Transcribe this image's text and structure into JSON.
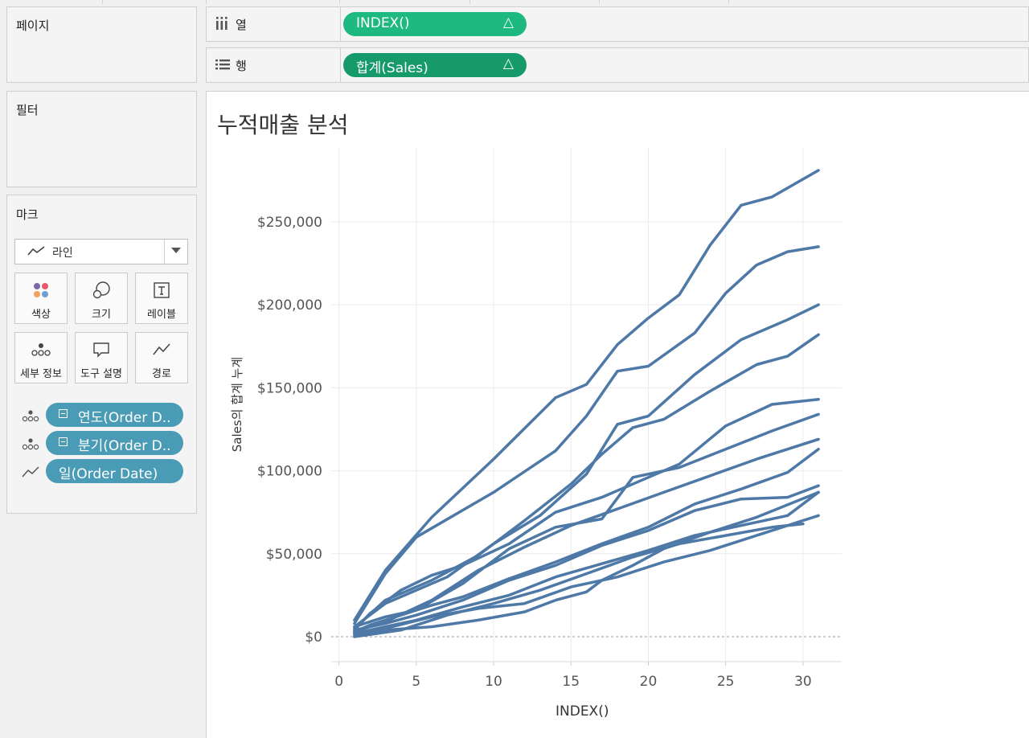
{
  "shelves": {
    "pages_label": "페이지",
    "columns": {
      "label": "열",
      "pill": "INDEX()",
      "pill_color": "#1db980"
    },
    "rows": {
      "label": "행",
      "pill": "합계(Sales)",
      "pill_color": "#169a6b"
    }
  },
  "filters": {
    "label": "필터"
  },
  "marks": {
    "label": "마크",
    "type": "라인",
    "buttons": {
      "color": "색상",
      "size": "크기",
      "label": "레이블",
      "detail": "세부 정보",
      "tooltip": "도구 설명",
      "path": "경로"
    },
    "fields": [
      {
        "text": "연도(Order D..",
        "role": "detail"
      },
      {
        "text": "분기(Order D..",
        "role": "detail"
      },
      {
        "text": "일(Order Date)",
        "role": "path"
      }
    ],
    "field_color": "#4a9bb5"
  },
  "sheet": {
    "title": "누적매출 분석"
  },
  "chart_data": {
    "type": "line",
    "title": "누적매출 분석",
    "xlabel": "INDEX()",
    "ylabel": "Sales의 합계 누계",
    "xlim": [
      -0.5,
      32.5
    ],
    "ylim": [
      -15000,
      295000
    ],
    "xticks": [
      0,
      5,
      10,
      15,
      20,
      25,
      30
    ],
    "yticks": [
      0,
      50000,
      100000,
      150000,
      200000,
      250000
    ],
    "ytick_labels": [
      "$0",
      "$50,000",
      "$100,000",
      "$150,000",
      "$200,000",
      "$250,000"
    ],
    "line_color": "#4e79a7",
    "grid": true,
    "zero_line": "dashed",
    "series": [
      {
        "x": [
          1,
          3,
          6,
          10,
          14,
          16,
          18,
          20,
          22,
          24,
          26,
          28,
          31
        ],
        "values": [
          10000,
          40000,
          72000,
          107000,
          144000,
          152000,
          176000,
          192000,
          206000,
          236000,
          260000,
          265000,
          281000
        ]
      },
      {
        "x": [
          1,
          3,
          5,
          10,
          14,
          16,
          18,
          20,
          23,
          25,
          27,
          29,
          31
        ],
        "values": [
          8000,
          38000,
          60000,
          87000,
          112000,
          133000,
          160000,
          163000,
          183000,
          207000,
          224000,
          232000,
          235000
        ]
      },
      {
        "x": [
          1,
          3,
          7,
          10,
          13,
          16,
          18,
          20,
          23,
          26,
          29,
          31
        ],
        "values": [
          6000,
          20000,
          36000,
          56000,
          73000,
          98000,
          128000,
          133000,
          158000,
          179000,
          191000,
          200000
        ]
      },
      {
        "x": [
          1,
          3,
          6,
          9,
          12,
          15,
          17,
          19,
          21,
          24,
          27,
          29,
          31
        ],
        "values": [
          5000,
          22000,
          34000,
          49000,
          70000,
          92000,
          110000,
          126000,
          131000,
          148000,
          164000,
          169000,
          182000
        ]
      },
      {
        "x": [
          1,
          2,
          4,
          6,
          8,
          11,
          14,
          17,
          20,
          22,
          25,
          28,
          31
        ],
        "values": [
          4000,
          14000,
          28000,
          37000,
          43000,
          56000,
          75000,
          84000,
          96000,
          104000,
          127000,
          140000,
          143000
        ]
      },
      {
        "x": [
          1,
          3,
          5,
          8,
          11,
          14,
          17,
          19,
          22,
          25,
          28,
          31
        ],
        "values": [
          6000,
          12000,
          16000,
          32000,
          53000,
          66000,
          71000,
          96000,
          102000,
          113000,
          124000,
          134000
        ]
      },
      {
        "x": [
          1,
          3,
          6,
          9,
          12,
          15,
          18,
          21,
          24,
          27,
          31
        ],
        "values": [
          3000,
          9000,
          22000,
          40000,
          54000,
          67000,
          77000,
          87000,
          97000,
          107000,
          119000
        ]
      },
      {
        "x": [
          1,
          2,
          4,
          6,
          8,
          11,
          14,
          17,
          20,
          23,
          26,
          29,
          31
        ],
        "values": [
          3000,
          7000,
          13000,
          19000,
          24000,
          35000,
          45000,
          56000,
          66000,
          80000,
          89000,
          99000,
          113000
        ]
      },
      {
        "x": [
          1,
          3,
          5,
          8,
          11,
          14,
          17,
          20,
          23,
          26,
          29,
          31
        ],
        "values": [
          4000,
          8000,
          13000,
          22000,
          34000,
          43000,
          55000,
          64000,
          76000,
          83000,
          84000,
          91000
        ]
      },
      {
        "x": [
          1,
          3,
          5,
          8,
          11,
          14,
          17,
          20,
          23,
          26,
          29,
          31
        ],
        "values": [
          2000,
          6000,
          10000,
          18000,
          25000,
          36000,
          44000,
          52000,
          61000,
          67000,
          73000,
          87000
        ]
      },
      {
        "x": [
          1,
          3,
          6,
          9,
          12,
          15,
          18,
          21,
          24,
          27,
          31
        ],
        "values": [
          2000,
          5000,
          12000,
          17000,
          20000,
          30000,
          36000,
          45000,
          52000,
          61000,
          73000
        ]
      },
      {
        "x": [
          1,
          3,
          6,
          9,
          12,
          14,
          16,
          17,
          19,
          21,
          24,
          27,
          31
        ],
        "values": [
          1000,
          4000,
          6000,
          10000,
          15000,
          22000,
          27000,
          34000,
          43000,
          53000,
          63000,
          72000,
          87000
        ]
      },
      {
        "x": [
          1,
          4,
          7,
          10,
          13,
          16,
          19,
          22,
          25,
          28,
          30
        ],
        "values": [
          0,
          4000,
          13000,
          20000,
          28000,
          38000,
          48000,
          56000,
          61000,
          66000,
          68000
        ]
      }
    ]
  }
}
